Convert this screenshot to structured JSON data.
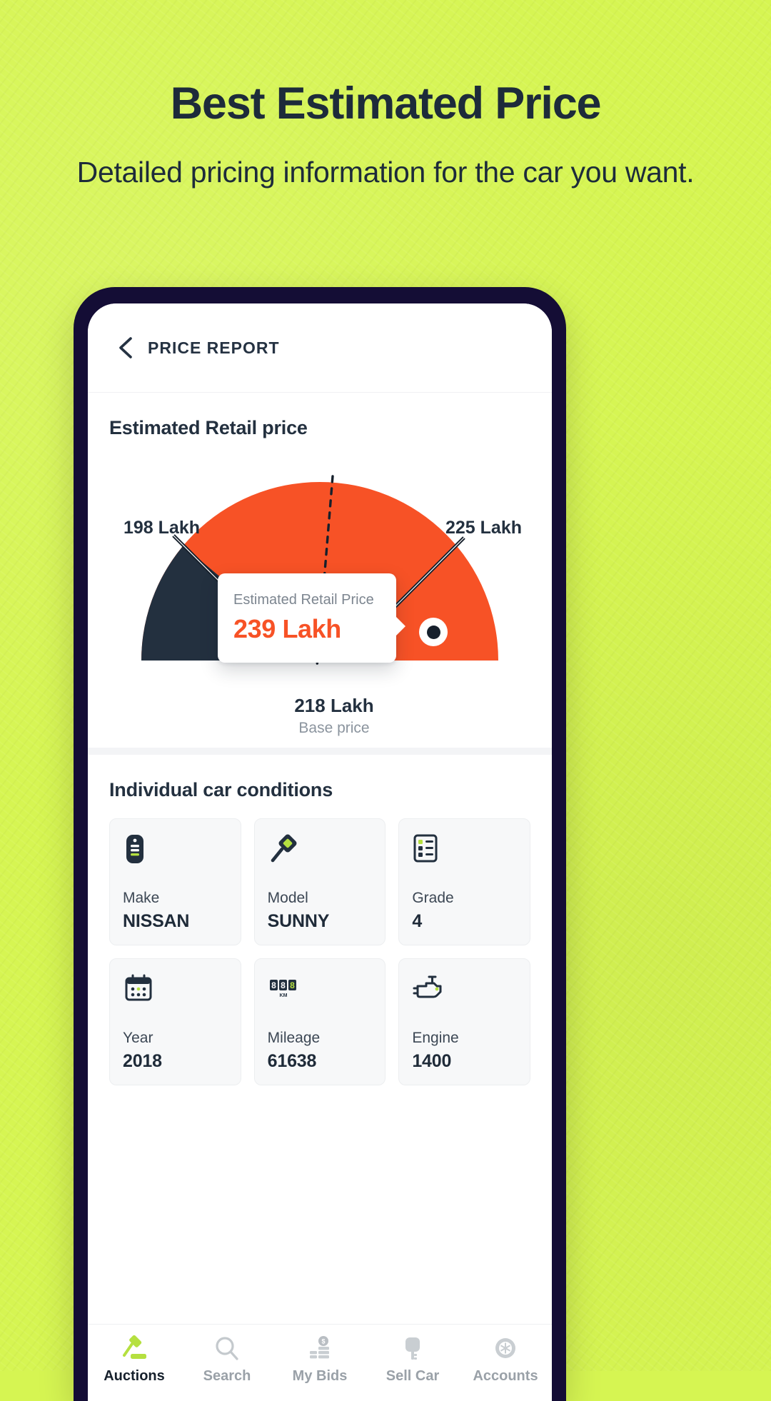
{
  "theme": {
    "background_green": "#d6f552",
    "dark_navy": "#140d35",
    "accent_orange": "#f75226",
    "gauge_dark": "#23303f",
    "text_dark": "#1d2b3a",
    "muted_gray": "#9aa1a8",
    "lime_accent": "#b5e040"
  },
  "hero": {
    "title": "Best Estimated Price",
    "subtitle": "Detailed pricing information for the car you want."
  },
  "appbar": {
    "back_icon": "chevron-left-icon",
    "title": "PRICE REPORT"
  },
  "price_section": {
    "title": "Estimated Retail price",
    "tooltip": {
      "label": "Estimated Retail Price",
      "value": "239 Lakh"
    },
    "base": {
      "value": "218 Lakh",
      "label": "Base price"
    }
  },
  "chart_data": {
    "type": "gauge",
    "title": "Estimated Retail price",
    "unit": "Lakh",
    "min": 198,
    "max": 225,
    "min_label": "198 Lakh",
    "max_label": "225 Lakh",
    "base_price": 218,
    "base_price_label": "218 Lakh",
    "base_price_caption": "Base price",
    "estimated_retail_price": 239,
    "estimated_retail_price_label": "239 Lakh",
    "pointer_angle_deg": 168,
    "segments": [
      {
        "name": "below-range",
        "color": "#23303f",
        "start_deg": 180,
        "end_deg": 140
      },
      {
        "name": "in-range",
        "color": "#f75226",
        "start_deg": 140,
        "end_deg": 0
      }
    ],
    "tick_marks_deg": [
      140,
      34
    ],
    "dashed_marker_deg": 96,
    "legend": [],
    "grid": false
  },
  "conditions": {
    "title": "Individual car conditions",
    "cards": [
      {
        "icon": "car-key-fob-icon",
        "label": "Make",
        "value": "NISSAN"
      },
      {
        "icon": "tag-magnifier-icon",
        "label": "Model",
        "value": "SUNNY"
      },
      {
        "icon": "checklist-icon",
        "label": "Grade",
        "value": "4"
      },
      {
        "icon": "calendar-icon",
        "label": "Year",
        "value": "2018"
      },
      {
        "icon": "odometer-icon",
        "label": "Mileage",
        "value": "61638"
      },
      {
        "icon": "engine-icon",
        "label": "Engine",
        "value": "1400"
      }
    ]
  },
  "bottom_nav": {
    "items": [
      {
        "icon": "gavel-icon",
        "label": "Auctions",
        "active": true
      },
      {
        "icon": "search-icon",
        "label": "Search",
        "active": false
      },
      {
        "icon": "coins-icon",
        "label": "My Bids",
        "active": false
      },
      {
        "icon": "car-key-icon",
        "label": "Sell Car",
        "active": false
      },
      {
        "icon": "wheel-icon",
        "label": "Accounts",
        "active": false
      }
    ]
  }
}
